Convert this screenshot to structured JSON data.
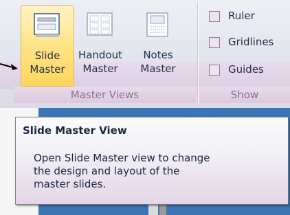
{
  "ribbon": {
    "master_views": {
      "group_label": "Master Views",
      "buttons": [
        {
          "line1": "Slide",
          "line2": "Master",
          "icon": "slide-master-icon",
          "active": true
        },
        {
          "line1": "Handout",
          "line2": "Master",
          "icon": "handout-master-icon",
          "active": false
        },
        {
          "line1": "Notes",
          "line2": "Master",
          "icon": "notes-master-icon",
          "active": false
        }
      ]
    },
    "show": {
      "group_label": "Show",
      "checkboxes": [
        {
          "label": "Ruler",
          "checked": false
        },
        {
          "label": "Gridlines",
          "checked": false
        },
        {
          "label": "Guides",
          "checked": false
        }
      ]
    }
  },
  "tooltip": {
    "title": "Slide Master View",
    "body_lines": [
      "Open Slide Master view to change",
      "the design and layout of the",
      "master slides."
    ]
  },
  "colors": {
    "active_button": "#ffd65c",
    "group_label_text": "#8a6f91",
    "background_blue": "#3b75b5"
  }
}
